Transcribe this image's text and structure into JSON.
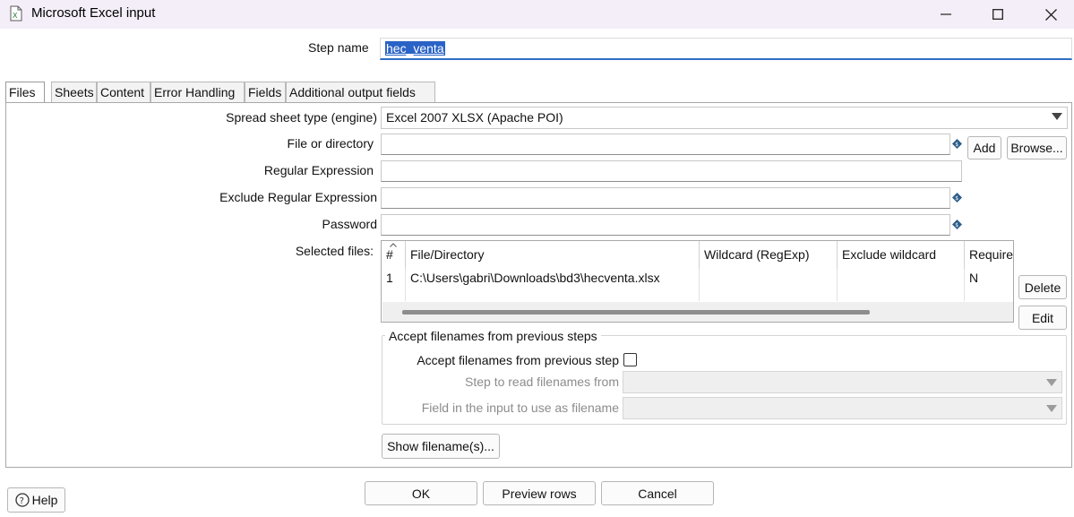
{
  "window": {
    "title": "Microsoft Excel input",
    "minimize_icon": "minimize-icon",
    "maximize_icon": "maximize-icon",
    "close_icon": "close-icon"
  },
  "step_name": {
    "label": "Step name",
    "value": "hec_venta"
  },
  "tabs": [
    {
      "label": "Files",
      "active": true
    },
    {
      "label": "Sheets"
    },
    {
      "label": "Content"
    },
    {
      "label": "Error Handling"
    },
    {
      "label": "Fields"
    },
    {
      "label": "Additional output fields"
    }
  ],
  "files": {
    "spreadsheet_type_label": "Spread sheet type (engine)",
    "spreadsheet_type_value": "Excel 2007 XLSX (Apache POI)",
    "file_or_directory_label": "File or directory",
    "file_or_directory_value": "",
    "add_label": "Add",
    "browse_label": "Browse...",
    "regex_label": "Regular Expression",
    "regex_value": "",
    "exclude_regex_label": "Exclude Regular Expression",
    "exclude_regex_value": "",
    "password_label": "Password",
    "password_value": "",
    "selected_files_label": "Selected files:",
    "table": {
      "columns": [
        "#",
        "File/Directory",
        "Wildcard (RegExp)",
        "Exclude wildcard",
        "Require"
      ],
      "rows": [
        {
          "num": "1",
          "file": "C:\\Users\\gabri\\Downloads\\bd3\\hecventa.xlsx",
          "wildcard": "",
          "exclude": "",
          "required": "N"
        }
      ]
    },
    "delete_label": "Delete",
    "edit_label": "Edit",
    "accept_group_title": "Accept filenames from previous steps",
    "accept_checkbox_label": "Accept filenames from previous step",
    "accept_checked": false,
    "step_to_read_label": "Step to read filenames from",
    "field_input_label": "Field in the input to use as filename",
    "show_filenames_label": "Show filename(s)..."
  },
  "footer": {
    "help_label": "Help",
    "ok_label": "OK",
    "preview_label": "Preview rows",
    "cancel_label": "Cancel"
  },
  "colors": {
    "titlebar": "#f4eef8",
    "selection": "#2a63c6",
    "focus_underline": "#2f6fc4"
  }
}
